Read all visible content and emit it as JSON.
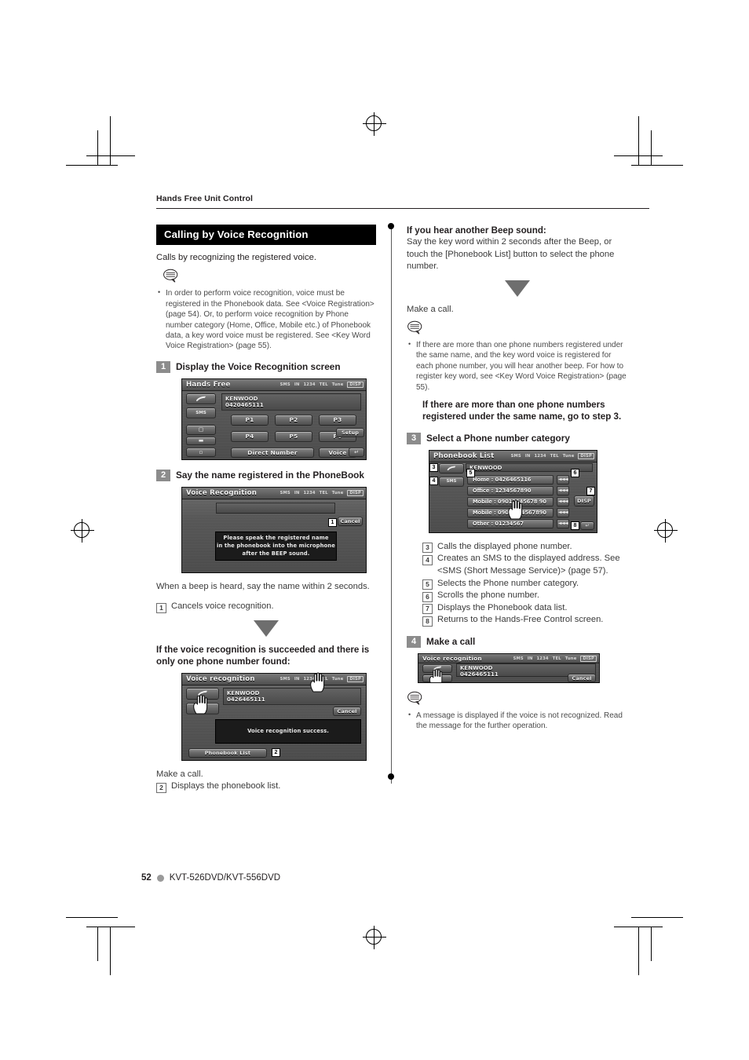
{
  "page": {
    "running_head": "Hands Free Unit Control",
    "page_number": "52",
    "model": "KVT-526DVD/KVT-556DVD"
  },
  "left_column": {
    "section_title": "Calling by Voice Recognition",
    "intro": "Calls by recognizing the registered voice.",
    "notes": [
      "In order to perform voice recognition, voice must be registered in the Phonebook  data. See <Voice Registration> (page 54). Or, to perform voice recognition by Phone number category (Home, Office, Mobile etc.) of Phonebook data, a key word voice must be registered. See <Key Word Voice Registration> (page 55)."
    ],
    "step1": {
      "num": "1",
      "title": "Display the Voice Recognition screen"
    },
    "step2": {
      "num": "2",
      "title": "Say the name registered in the PhoneBook"
    },
    "after_step2_text": "When a beep is heard, say the name within 2 seconds.",
    "callout_cancel": {
      "num": "1",
      "text": "Cancels voice recognition."
    },
    "success_heading": "If the voice recognition is succeeded and there is only one phone number found:",
    "make_a_call": "Make a call.",
    "callout_phonebook": {
      "num": "2",
      "text": "Displays the phonebook list."
    }
  },
  "right_column": {
    "beep_heading": "If you hear another Beep sound:",
    "beep_body": "Say the key word within 2 seconds after the Beep, or touch the [Phonebook List] button to select the phone number.",
    "make_a_call": "Make a call.",
    "notes": [
      "If there are more than one phone numbers registered under the same name, and the key word voice is registered for each phone number, you will hear another beep. For how to register key word, see <Key Word Voice Registration> (page 55)."
    ],
    "more_numbers_heading": "If there are more than one phone numbers registered under the same name, go to step 3.",
    "step3": {
      "num": "3",
      "title": "Select a Phone number category"
    },
    "callouts": [
      {
        "num": "3",
        "text": "Calls the displayed phone number."
      },
      {
        "num": "4",
        "text": "Creates an SMS to the displayed address. See <SMS (Short Message Service)> (page 57)."
      },
      {
        "num": "5",
        "text": "Selects the Phone number category."
      },
      {
        "num": "6",
        "text": "Scrolls the phone number."
      },
      {
        "num": "7",
        "text": "Displays the Phonebook data list."
      },
      {
        "num": "8",
        "text": "Returns to the Hands-Free Control screen."
      }
    ],
    "step4": {
      "num": "4",
      "title": "Make a call"
    },
    "final_notes": [
      "A message is displayed if the voice is not recognized. Read the message for the further operation."
    ]
  },
  "screens": {
    "hands_free": {
      "title": "Hands Free",
      "caller_name": "KENWOOD",
      "caller_number": "0420465111",
      "sms_label": "SMS",
      "presets": [
        "P1",
        "P2",
        "P3",
        "P4",
        "P5",
        "P6"
      ],
      "direct_number": "Direct Number",
      "voice": "Voice",
      "setup": "Setup",
      "status": [
        "SMS",
        "IN",
        "1234",
        "TEL",
        "Tune",
        "DISP"
      ]
    },
    "voice_recognition_prompt": {
      "title": "Voice Recognition",
      "cancel": "Cancel",
      "message_lines": [
        "Please speak the registered name",
        "in the phonebook into the microphone",
        "after the BEEP sound."
      ],
      "callout_num": "1"
    },
    "voice_recognition_success": {
      "title": "Voice recognition",
      "caller_name": "KENWOOD",
      "caller_number": "0426465111",
      "cancel": "Cancel",
      "message": "Voice recognition success.",
      "phonebook_list": "Phonebook List",
      "callout_num": "2"
    },
    "phonebook_list": {
      "title": "Phonebook List",
      "caller_name": "KENWOOD",
      "sms_label": "SMS",
      "disp_label": "DISP",
      "entries": [
        "Home : 0426465116",
        "Office : 1234567890",
        "Mobile : 09012345678 90",
        "Mobile : 090123 4567890",
        "Other : 01234567"
      ],
      "scroll_glyph": "◄◄◄",
      "callout_nums": [
        "3",
        "4",
        "5",
        "6",
        "7",
        "8"
      ]
    },
    "make_call": {
      "title": "Voice recognition",
      "caller_name": "KENWOOD",
      "caller_number": "0426465111",
      "cancel": "Cancel"
    }
  }
}
